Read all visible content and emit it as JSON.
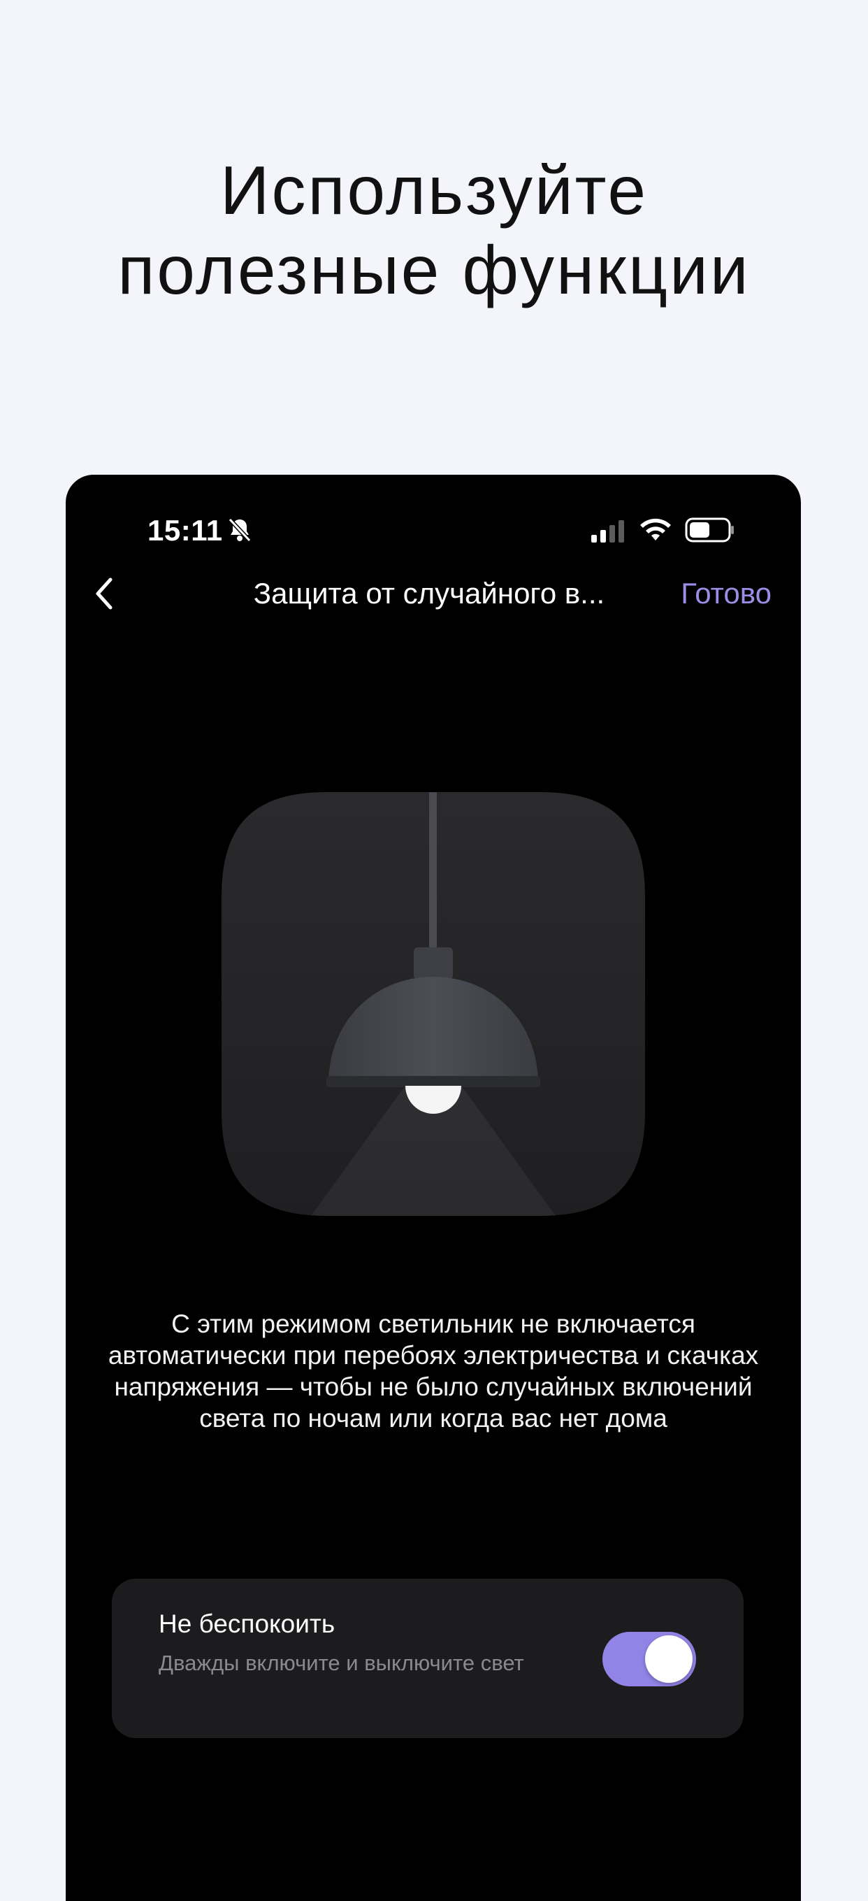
{
  "promo": {
    "title_line1": "Используйте",
    "title_line2": "полезные функции"
  },
  "status_bar": {
    "time": "15:11",
    "icons": [
      "bell-slash-icon",
      "signal-icon",
      "wifi-icon",
      "battery-icon"
    ]
  },
  "nav": {
    "back_icon": "chevron-left-icon",
    "title": "Защита от случайного в...",
    "done_label": "Готово"
  },
  "illustration": {
    "icon": "pendant-lamp-icon"
  },
  "description": "С этим режимом светильник не включается автоматически при перебоях электричества и скачках напряжения  — чтобы не было случайных включений света по ночам или когда вас нет дома",
  "setting": {
    "title": "Не беспокоить",
    "subtitle": "Дважды включите и выключите свет",
    "toggle_on": true
  },
  "colors": {
    "page_background": "#f3f5fa",
    "phone_background": "#000000",
    "card_background": "#1c1c1e",
    "accent": "#9184e6",
    "done_text": "#9b8ee6"
  }
}
